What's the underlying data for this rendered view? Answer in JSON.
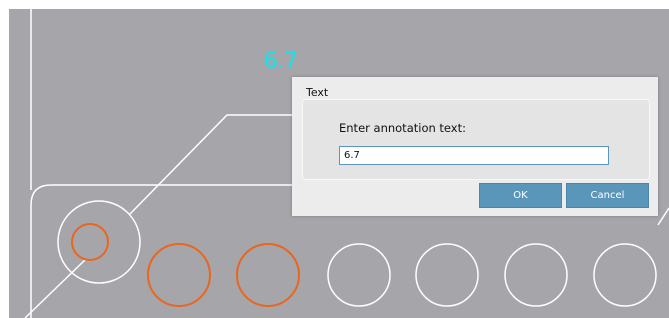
{
  "canvas": {
    "background": "#a6a5aa",
    "line_color": "#ffffff",
    "highlight_color": "#e8661e",
    "annotation": {
      "text": "6.7",
      "color": "#12e3ef"
    }
  },
  "dialog": {
    "title": "Text",
    "prompt": "Enter annotation text:",
    "input_value": "6.7",
    "ok_label": "OK",
    "cancel_label": "Cancel",
    "button_color": "#5a96ba"
  }
}
